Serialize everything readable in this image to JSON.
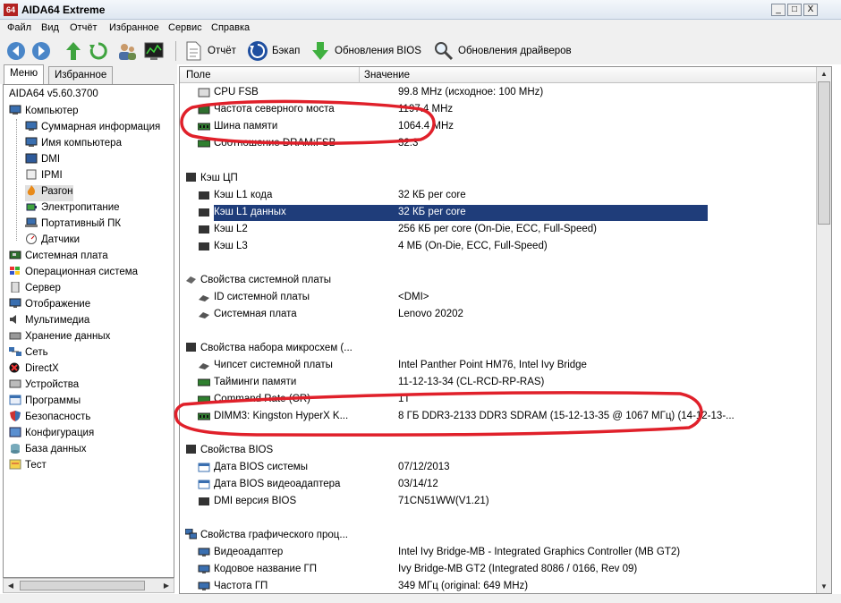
{
  "window": {
    "logo": "64",
    "title": "AIDA64 Extreme",
    "controls": {
      "minimize": "_",
      "maximize": "□",
      "close": "X"
    }
  },
  "menu": [
    "Файл",
    "Вид",
    "Отчёт",
    "Избранное",
    "Сервис",
    "Справка"
  ],
  "toolbar": {
    "report_label": "Отчёт",
    "backup_label": "Бэкап",
    "bios_updates_label": "Обновления BIOS",
    "driver_updates_label": "Обновления драйверов"
  },
  "left_tabs": {
    "menu": "Меню",
    "favorites": "Избранное"
  },
  "tree": {
    "version": "AIDA64 v5.60.3700",
    "computer": "Компьютер",
    "computer_children": [
      "Суммарная информация",
      "Имя компьютера",
      "DMI",
      "IPMI",
      "Разгон",
      "Электропитание",
      "Портативный ПК",
      "Датчики"
    ],
    "top_level": [
      "Системная плата",
      "Операционная система",
      "Сервер",
      "Отображение",
      "Мультимедиа",
      "Хранение данных",
      "Сеть",
      "DirectX",
      "Устройства",
      "Программы",
      "Безопасность",
      "Конфигурация",
      "База данных",
      "Тест"
    ]
  },
  "columns": {
    "field": "Поле",
    "value": "Значение"
  },
  "top_rows": [
    {
      "field": "CPU FSB",
      "value": "99.8 MHz  (исходное: 100 MHz)"
    },
    {
      "field": "Частота северного моста",
      "value": "1197.4 MHz"
    },
    {
      "field": "Шина памяти",
      "value": "1064.4 MHz"
    },
    {
      "field": "Соотношение DRAM:FSB",
      "value": "32:3"
    }
  ],
  "sections": {
    "cache": "Кэш ЦП",
    "board": "Свойства системной платы",
    "chipset": "Свойства набора микросхем (...",
    "bios": "Свойства BIOS",
    "gpu": "Свойства графического проц..."
  },
  "cache_rows": [
    {
      "field": "Кэш L1 кода",
      "value": "32 КБ per core"
    },
    {
      "field": "Кэш L1 данных",
      "value": "32 КБ per core"
    },
    {
      "field": "Кэш L2",
      "value": "256 КБ per core  (On-Die, ECC, Full-Speed)"
    },
    {
      "field": "Кэш L3",
      "value": "4 МБ  (On-Die, ECC, Full-Speed)"
    }
  ],
  "board_rows": [
    {
      "field": "ID системной платы",
      "value": "<DMI>"
    },
    {
      "field": "Системная плата",
      "value": "Lenovo 20202"
    }
  ],
  "chipset_rows": [
    {
      "field": "Чипсет системной платы",
      "value": "Intel Panther Point HM76, Intel Ivy Bridge"
    },
    {
      "field": "Тайминги памяти",
      "value": "11-12-13-34  (CL-RCD-RP-RAS)"
    },
    {
      "field": "Command Rate (CR)",
      "value": "1T"
    },
    {
      "field": "DIMM3: Kingston HyperX K...",
      "value": "8 ГБ DDR3-2133 DDR3 SDRAM  (15-12-13-35 @ 1067 МГц)  (14-12-13-..."
    }
  ],
  "bios_rows": [
    {
      "field": "Дата BIOS системы",
      "value": "07/12/2013"
    },
    {
      "field": "Дата BIOS видеоадаптера",
      "value": "03/14/12"
    },
    {
      "field": "DMI версия BIOS",
      "value": "71CN51WW(V1.21)"
    }
  ],
  "gpu_rows": [
    {
      "field": "Видеоадаптер",
      "value": "Intel Ivy Bridge-MB - Integrated Graphics Controller (MB GT2)"
    },
    {
      "field": "Кодовое название ГП",
      "value": "Ivy Bridge-MB GT2  (Integrated 8086 / 0166, Rev 09)"
    },
    {
      "field": "Частота ГП",
      "value": "349 МГц  (original: 649 MHz)"
    }
  ],
  "colors": {
    "selection": "#1f3d7a",
    "annotation": "#e0202a"
  }
}
